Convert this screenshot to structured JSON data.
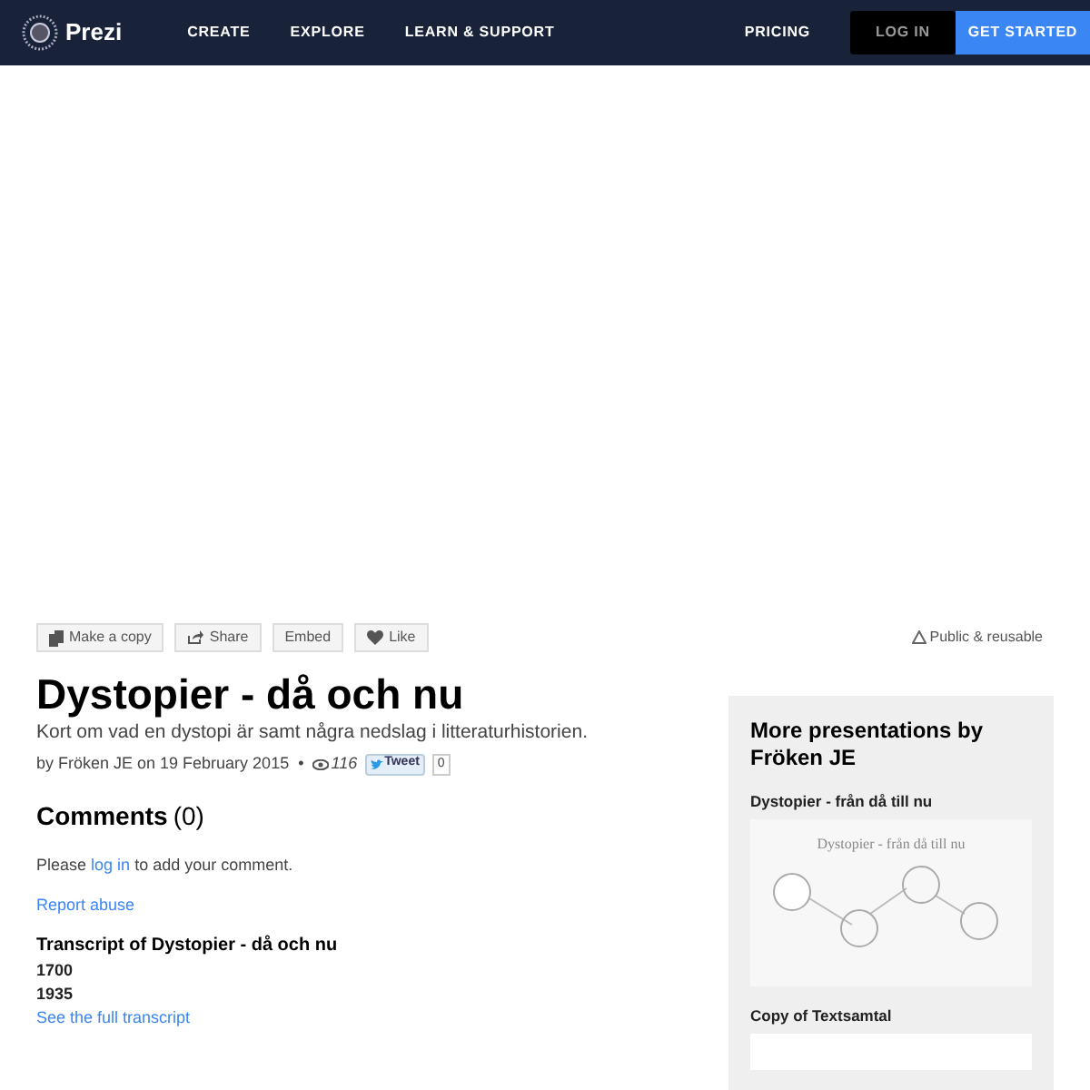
{
  "nav": {
    "logo": "Prezi",
    "links": [
      "CREATE",
      "EXPLORE",
      "LEARN & SUPPORT"
    ],
    "pricing": "PRICING",
    "login": "LOG IN",
    "get_started": "GET STARTED"
  },
  "actions": [
    {
      "kind": "copy",
      "label": "Make a copy"
    },
    {
      "kind": "share",
      "label": "Share"
    },
    {
      "kind": "plain",
      "label": "Embed"
    },
    {
      "kind": "like",
      "label": "Like"
    }
  ],
  "license": "Public & reusable",
  "title": "Dystopier - då och nu",
  "description": "Kort om vad en dystopi är samt några nedslag i litteraturhistorien.",
  "meta": {
    "byline": "by Fröken JE on 19 February 2015",
    "separator": "•",
    "views": "116",
    "tweet": "Tweet",
    "tweet_count": "0"
  },
  "comments": {
    "heading": "Comments",
    "count": "(0)",
    "prompt_before": "Please",
    "login_link": "log in",
    "prompt_after": "to add your comment.",
    "report": "Report abuse"
  },
  "transcript": {
    "heading": "Transcript of Dystopier - då och nu",
    "lines": [
      "1700",
      "1935"
    ],
    "link": "See the full transcript"
  },
  "sidebar": {
    "heading": "More presentations by Fröken JE",
    "items": [
      {
        "title": "Dystopier - från då till nu",
        "slide_title": "Dystopier - från då till nu"
      },
      {
        "title": "Copy of Textsamtal"
      }
    ]
  }
}
